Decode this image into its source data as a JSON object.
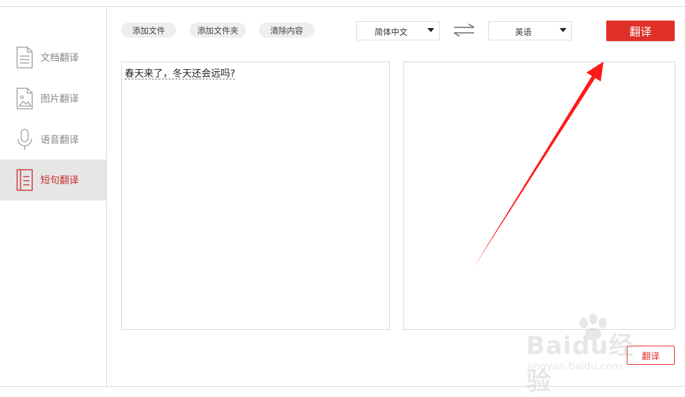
{
  "sidebar": {
    "items": [
      {
        "label": "文档翻译",
        "icon": "document-icon",
        "active": false
      },
      {
        "label": "图片翻译",
        "icon": "image-icon",
        "active": false
      },
      {
        "label": "语音翻译",
        "icon": "microphone-icon",
        "active": false
      },
      {
        "label": "短句翻译",
        "icon": "sentence-icon",
        "active": true
      }
    ]
  },
  "toolbar": {
    "add_file": "添加文件",
    "add_folder": "添加文件夹",
    "clear_content": "清除内容",
    "source_language": "简体中文",
    "target_language": "英语",
    "translate_label": "翻译",
    "swap_icon": "swap-arrows-icon"
  },
  "source_pane": {
    "text": "春天来了，冬天还会远吗?"
  },
  "target_pane": {
    "text": ""
  },
  "bottom": {
    "translate_label": "翻译"
  },
  "annotation": {
    "arrow_color": "#ff1a1a"
  },
  "watermark": {
    "brand": "Baidu经验",
    "url": "jingyan.baidu.com"
  },
  "colors": {
    "accent": "#e0302a",
    "active_nav_bg": "#e6e6e6",
    "active_nav_text": "#c8302c"
  }
}
